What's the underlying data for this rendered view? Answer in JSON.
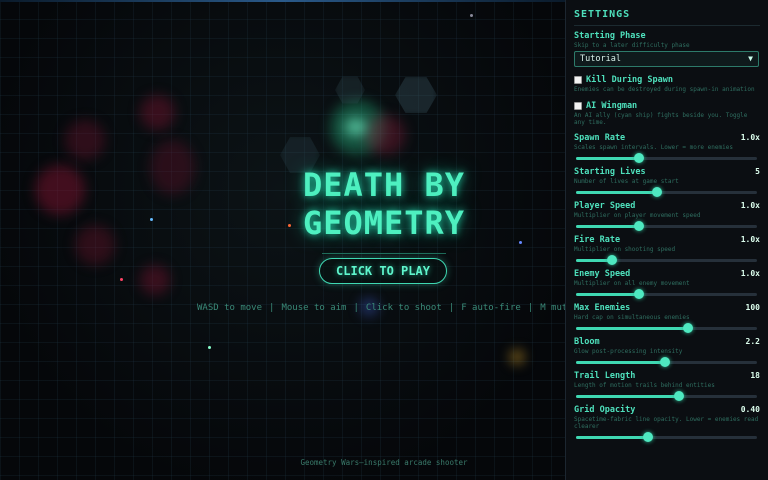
{
  "game": {
    "title_line1": "DEATH BY",
    "title_line2": "GEOMETRY",
    "play_button": "CLICK TO PLAY",
    "controls": [
      "WASD to move",
      "Mouse to aim",
      "Click to shoot",
      "F auto-fire",
      "M mut"
    ],
    "tagline": "Geometry Wars–inspired arcade shooter",
    "colors": {
      "accent": "#4ef0c0",
      "background": "#05070a",
      "panel": "#0b0e12"
    }
  },
  "settings": {
    "title": "SETTINGS",
    "starting_phase": {
      "label": "Starting Phase",
      "desc": "Skip to a later difficulty phase",
      "value": "Tutorial"
    },
    "kill_during_spawn": {
      "label": "Kill During Spawn",
      "desc": "Enemies can be destroyed during spawn-in animation",
      "checked": false
    },
    "ai_wingman": {
      "label": "AI Wingman",
      "desc": "An AI ally (cyan ship) fights beside you. Toggle any time.",
      "checked": false
    },
    "sliders": [
      {
        "label": "Spawn Rate",
        "value": "1.0x",
        "desc": "Scales spawn intervals. Lower = more enemies",
        "level": 0.35
      },
      {
        "label": "Starting Lives",
        "value": "5",
        "desc": "Number of lives at game start",
        "level": 0.45
      },
      {
        "label": "Player Speed",
        "value": "1.0x",
        "desc": "Multiplier on player movement speed",
        "level": 0.35
      },
      {
        "label": "Fire Rate",
        "value": "1.0x",
        "desc": "Multiplier on shooting speed",
        "level": 0.2
      },
      {
        "label": "Enemy Speed",
        "value": "1.0x",
        "desc": "Multiplier on all enemy movement",
        "level": 0.35
      },
      {
        "label": "Max Enemies",
        "value": "100",
        "desc": "Hard cap on simultaneous enemies",
        "level": 0.62
      },
      {
        "label": "Bloom",
        "value": "2.2",
        "desc": "Glow post-processing intensity",
        "level": 0.49
      },
      {
        "label": "Trail Length",
        "value": "18",
        "desc": "Length of motion trails behind entities",
        "level": 0.57
      },
      {
        "label": "Grid Opacity",
        "value": "0.40",
        "desc": "Spacetime-fabric line opacity. Lower = enemies read clearer",
        "level": 0.4
      }
    ]
  }
}
